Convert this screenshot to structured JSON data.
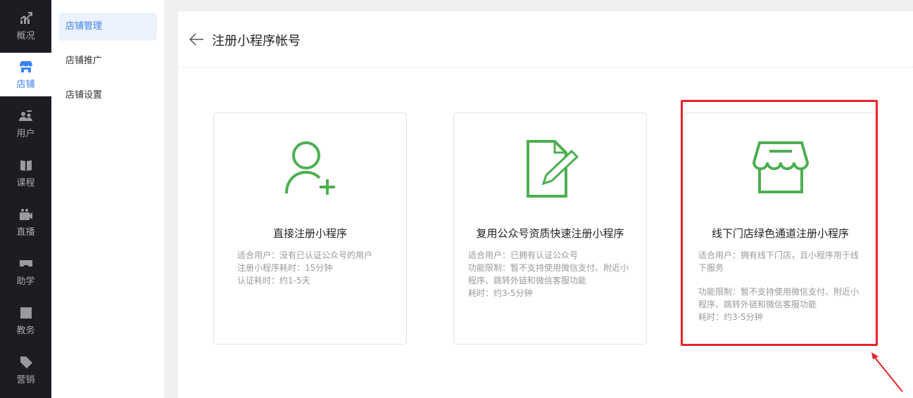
{
  "nav": [
    {
      "label": "概况",
      "icon": "chart-icon"
    },
    {
      "label": "店铺",
      "icon": "store-icon",
      "active": true
    },
    {
      "label": "用户",
      "icon": "users-icon"
    },
    {
      "label": "课程",
      "icon": "book-icon"
    },
    {
      "label": "直播",
      "icon": "video-icon"
    },
    {
      "label": "助学",
      "icon": "gamepad-icon"
    },
    {
      "label": "教务",
      "icon": "bookmark-icon"
    },
    {
      "label": "营销",
      "icon": "tag-icon"
    }
  ],
  "subnav": [
    {
      "label": "店铺管理",
      "active": true
    },
    {
      "label": "店铺推广"
    },
    {
      "label": "店铺设置"
    }
  ],
  "header": {
    "title": "注册小程序帐号"
  },
  "cards": [
    {
      "title": "直接注册小程序",
      "lines": [
        "适合用户：没有已认证公众号的用户",
        "注册小程序耗时：15分钟",
        "认证耗时：约1-5天"
      ]
    },
    {
      "title": "复用公众号资质快速注册小程序",
      "lines": [
        "适合用户：已拥有认证公众号",
        "功能限制：暂不支持使用微信支付、附近小程序、跳转外链和微信客服功能",
        "耗时：约3-5分钟"
      ]
    },
    {
      "title": "线下门店绿色通道注册小程序",
      "lines": [
        "适合用户：拥有线下门店，且小程序用于线下服务",
        "功能限制：暂不支持使用微信支付、附近小程序、跳转外链和微信客服功能",
        "耗时：约3-5分钟"
      ]
    }
  ],
  "colors": {
    "accent": "#3d82f2",
    "icon_green": "#4caf50",
    "highlight": "#e8232c"
  }
}
